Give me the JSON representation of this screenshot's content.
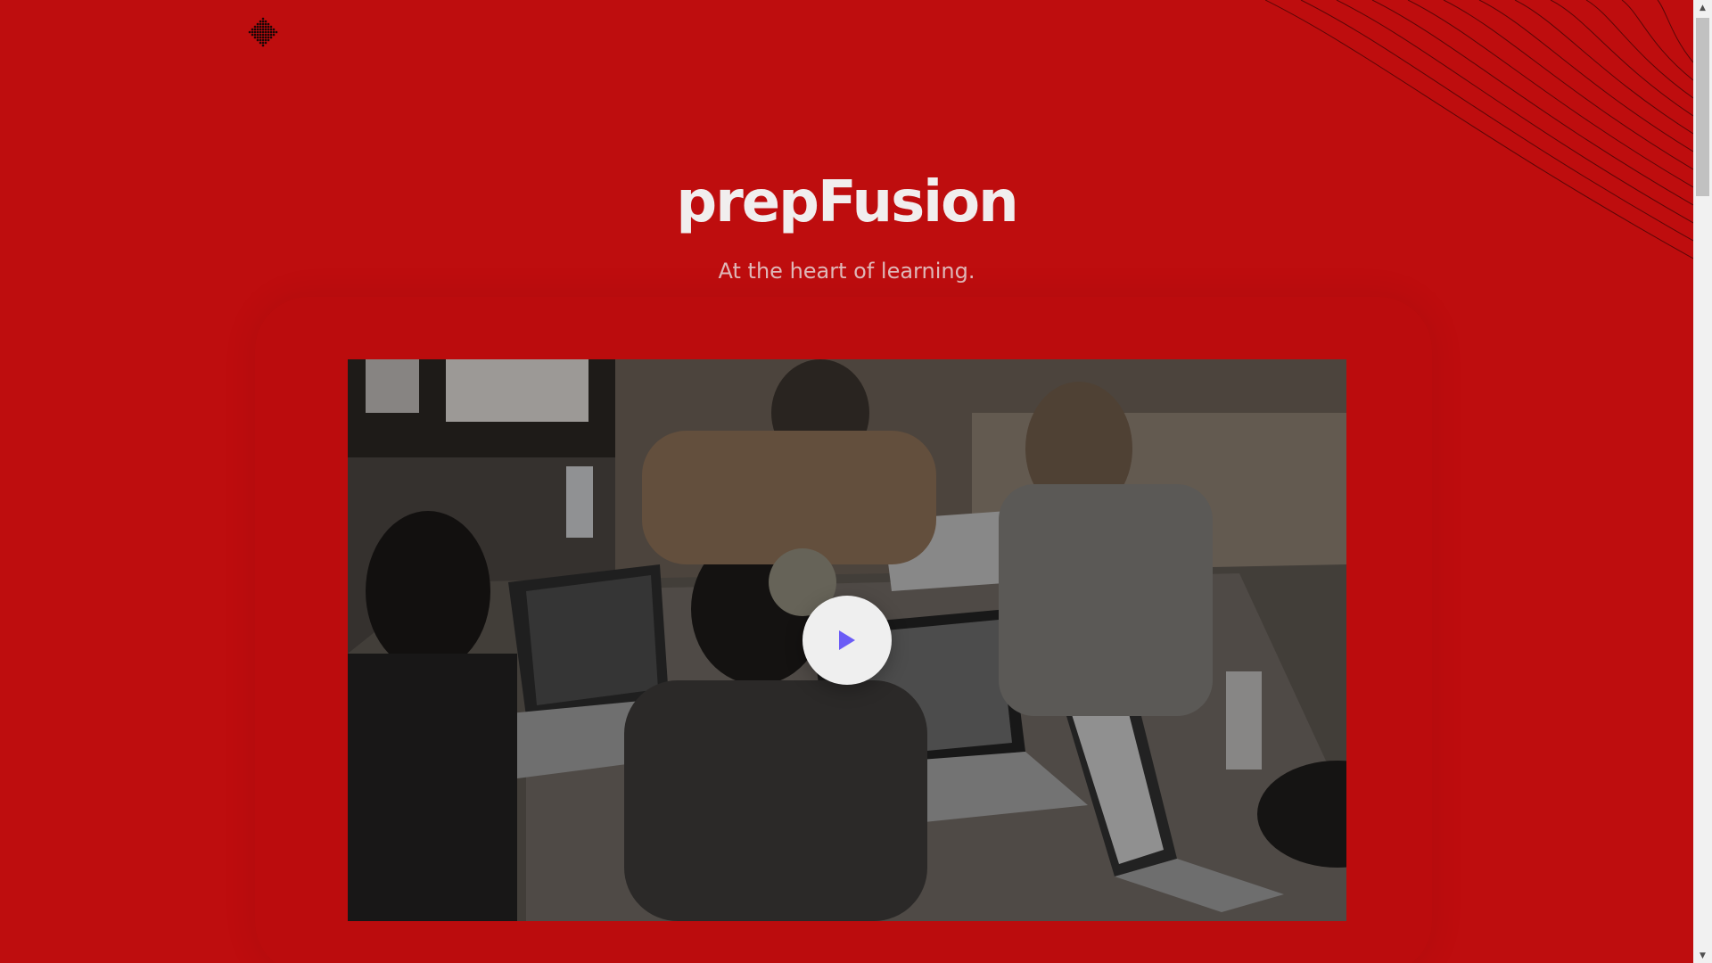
{
  "header": {
    "logo_icon": "dotted-diamond-logo-icon"
  },
  "hero": {
    "title": "prepFusion",
    "subtitle": "At the heart of learning."
  },
  "video": {
    "thumbnail": "photo of people working on laptops around a wooden table",
    "play_icon": "play-icon",
    "accent_color": "#6b5cf6"
  },
  "theme": {
    "background": "#be0d0e",
    "title_color": "#f1eeee",
    "subtitle_color": "#e0b8b8"
  },
  "scrollbar": {
    "up_icon": "scroll-up-arrow-icon",
    "down_icon": "scroll-down-arrow-icon"
  }
}
